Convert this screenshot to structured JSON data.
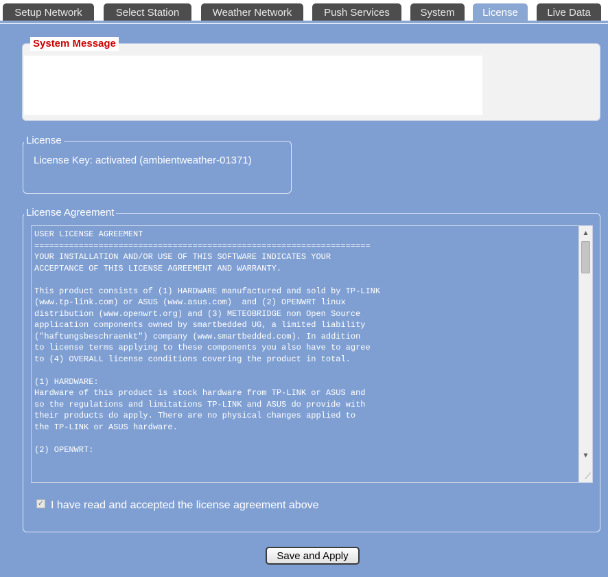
{
  "tabs": [
    {
      "label": "Setup Network",
      "active": false
    },
    {
      "label": "Select Station",
      "active": false
    },
    {
      "label": "Weather Network",
      "active": false
    },
    {
      "label": "Push Services",
      "active": false
    },
    {
      "label": "System",
      "active": false
    },
    {
      "label": "License",
      "active": true
    },
    {
      "label": "Live Data",
      "active": false
    }
  ],
  "system_message": {
    "legend": "System Message",
    "text": ""
  },
  "license": {
    "legend": "License",
    "key_text": "License Key: activated (ambientweather-01371)"
  },
  "agreement": {
    "legend": "License Agreement",
    "text": "USER LICENSE AGREEMENT\n====================================================================\nYOUR INSTALLATION AND/OR USE OF THIS SOFTWARE INDICATES YOUR\nACCEPTANCE OF THIS LICENSE AGREEMENT AND WARRANTY.\n\nThis product consists of (1) HARDWARE manufactured and sold by TP-LINK\n(www.tp-link.com) or ASUS (www.asus.com)  and (2) OPENWRT linux\ndistribution (www.openwrt.org) and (3) METEOBRIDGE non Open Source\napplication components owned by smartbedded UG, a limited liability\n(\"haftungsbeschraenkt\") company (www.smartbedded.com). In addition\nto license terms applying to these components you also have to agree\nto (4) OVERALL license conditions covering the product in total.\n\n(1) HARDWARE:\nHardware of this product is stock hardware from TP-LINK or ASUS and\nso the regulations and limitations TP-LINK and ASUS do provide with\ntheir products do apply. There are no physical changes applied to\nthe TP-LINK or ASUS hardware.\n\n(2) OPENWRT:",
    "accept_label": "I have read and accepted the license agreement above",
    "accepted": true
  },
  "save_button": "Save and Apply",
  "colors": {
    "background": "#7f9fd2",
    "tab_inactive": "#4d4d4d",
    "tab_active": "#8aa7d4",
    "legend_red": "#cc0000"
  }
}
